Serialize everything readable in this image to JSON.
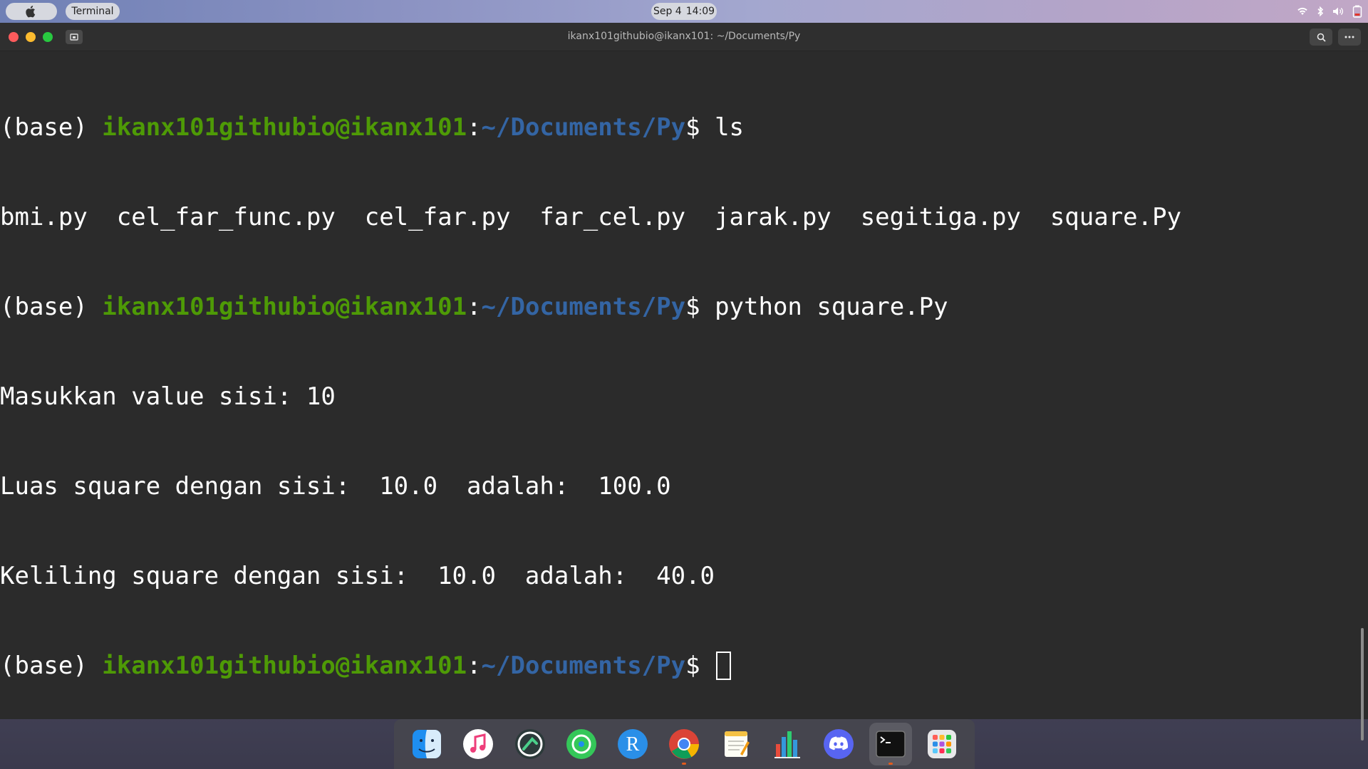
{
  "topbar": {
    "app_name": "Terminal",
    "date": "Sep 4",
    "time": "14:09",
    "tray_icons": [
      "wifi-icon",
      "bluetooth-icon",
      "volume-icon",
      "battery-icon"
    ]
  },
  "window": {
    "title": "ikanx101githubio@ikanx101: ~/Documents/Py"
  },
  "terminal": {
    "env": "(base) ",
    "user_host": "ikanx101githubio@ikanx101",
    "path": "~/Documents/Py",
    "prompt_symbol": "$ ",
    "command_1": "ls",
    "ls_output": "bmi.py  cel_far_func.py  cel_far.py  far_cel.py  jarak.py  segitiga.py  square.Py",
    "command_2": "python square.Py",
    "output_1": "Masukkan value sisi: 10",
    "output_2": "Luas square dengan sisi:  10.0  adalah:  100.0",
    "output_3": "Keliling square dengan sisi:  10.0  adalah:  40.0",
    "colors": {
      "user": "#4e9a06",
      "path": "#3465a4",
      "background": "#2b2b2b",
      "text": "#ffffff"
    }
  },
  "dock": {
    "items": [
      {
        "icon": "finder-icon"
      },
      {
        "icon": "music-icon"
      },
      {
        "icon": "activity-icon"
      },
      {
        "icon": "find-my-icon"
      },
      {
        "icon": "r-icon"
      },
      {
        "icon": "chrome-icon"
      },
      {
        "icon": "notes-icon"
      },
      {
        "icon": "stats-icon"
      },
      {
        "icon": "discord-icon"
      },
      {
        "icon": "terminal-icon",
        "active": true
      },
      {
        "icon": "launchpad-icon"
      }
    ],
    "r_letter": "R"
  }
}
